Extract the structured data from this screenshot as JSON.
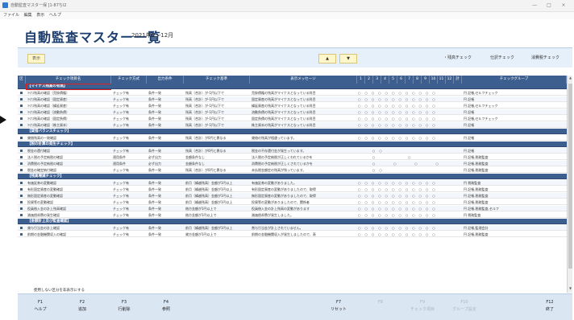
{
  "window": {
    "title": "自動監査マスター保 [1-87ちl2",
    "controls": [
      "—",
      "□",
      "×"
    ]
  },
  "menu": [
    "ファイル",
    "(E)",
    "編集",
    "(E)",
    "表示",
    "(E)",
    "ヘルプ",
    "(H)"
  ],
  "page": {
    "title": "自動監査マスター一覧",
    "period": "2021年1～12月"
  },
  "toolbar": {
    "left_button": "表示",
    "nav_left": "▲",
    "nav_right": "▼",
    "radio_labels": [
      "・残高チェック",
      "仕訳チェック",
      "消費税チェック"
    ]
  },
  "grid": {
    "columns": [
      "区",
      "チェック項目名",
      "チェック方式",
      "出力条件",
      "チェック基準",
      "表示メッセージ",
      "1",
      "2",
      "3",
      "4",
      "5",
      "6",
      "7",
      "8",
      "9",
      "10",
      "11",
      "12",
      "計",
      "チェックグループ"
    ],
    "groups": [
      {
        "title": "【マイナス残高の有無】",
        "rows": [
          {
            "name": "ﾏｲﾅｽ残高の確認（売掛債権）",
            "method": "チェック有",
            "cond": "条件一致",
            "base": "残高（合計）が-1円以下で",
            "msg": "売掛債権の残高がマイナスとなっている科目",
            "marks": "○○○○○○○○○○○○",
            "group": "円 記帳,セルフチェック"
          },
          {
            "name": "ﾏｲﾅｽ残高の確認（固定資産）",
            "method": "チェック有",
            "cond": "条件一致",
            "base": "残高（合計）が-1円以下で",
            "msg": "固定資産の残高がマイナスとなっている科目",
            "marks": "○○○○○○○○○○○○",
            "group": "円 記帳"
          },
          {
            "name": "ﾏｲﾅｽ残高の確認（繰延資産）",
            "method": "チェック有",
            "cond": "条件一致",
            "base": "残高（合計）が-1円以下で",
            "msg": "繰延資産の残高がマイナスとなっている科目",
            "marks": "○○○○○○○○○○○○",
            "group": "円 記帳,セルフチェック"
          },
          {
            "name": "ﾏｲﾅｽ残高の確認（流動負債）",
            "method": "チェック有",
            "cond": "条件一致",
            "base": "残高（合計）が-1円以下で",
            "msg": "流動負債の残高がマイナスとなっている科目",
            "marks": "○○○○○○○○○○○○",
            "group": "円 記帳"
          },
          {
            "name": "ﾏｲﾅｽ残高の確認（固定負債）",
            "method": "チェック有",
            "cond": "条件一致",
            "base": "残高（合計）が-1円以下で",
            "msg": "固定負債の残高がマイナスとなっている科目",
            "marks": "○○○○○○○○○○○○",
            "group": "円 記帳,セルフチェック"
          },
          {
            "name": "ﾏｲﾅｽ残高の確認（株主資本）",
            "method": "チェック有",
            "cond": "条件一致",
            "base": "残高（合計）が-1円以下で",
            "msg": "株主資本の残高がマイナスとなっている科目",
            "marks": "○○○○○○○○○○○○",
            "group": "円 記帳"
          }
        ]
      },
      {
        "title": "【貸借バランスチェック】",
        "rows": [
          {
            "name": "貸借残高の一致確認",
            "method": "チェック有",
            "cond": "条件一致",
            "base": "残高（合計）が0円と異なる",
            "msg": "貸借の残高が相違っています。",
            "marks": "○○○○○○○○○○○○",
            "group": "円 記帳"
          }
        ]
      },
      {
        "title": "【税の計算の発生チェック】",
        "rows": [
          {
            "name": "税金の還付確認",
            "method": "チェック有",
            "cond": "条件一致",
            "base": "残高（合計）が0円と異なる",
            "msg": "税金の不存還付金が発生っています。",
            "marks": "　　○○　　　　　　　　",
            "group": "円 記帳"
          },
          {
            "name": "法人税の予定納税の確認",
            "method": "適用条件",
            "cond": "必ず出力",
            "base": "金額条件なし",
            "msg": "法人税の予定納税が正しくわれているかを",
            "marks": "　　○　　　　○　　　　",
            "group": "円 記帳,税務監査"
          },
          {
            "name": "消費税の予定納税の確認",
            "method": "適用条件",
            "cond": "必ず出力",
            "base": "金額条件なし",
            "msg": "消費税の予定納税が正しくされているかを",
            "marks": "　　○　　○　　○　　○",
            "group": "円 記帳,税務監査"
          },
          {
            "name": "税金の確定納付確認",
            "method": "チェック有",
            "cond": "条件一致",
            "base": "残高（合計）が0円と異なる",
            "msg": "未払税金額定の残高が残っています。",
            "marks": "　　○○　　　　　　　　",
            "group": "円 記帳,税務監査"
          }
        ]
      },
      {
        "title": "【残高増減チェック】",
        "rows": [
          {
            "name": "有価証券の変動確認",
            "method": "チェック有",
            "cond": "条件一致",
            "base": "前月（繰越残高）金額が1円以上",
            "msg": "有価証券の変動がありました。",
            "marks": "○○○○○○○○○○○○",
            "group": "円 税務監査"
          },
          {
            "name": "有形固定資産の変動確認",
            "method": "チェック有",
            "cond": "条件一致",
            "base": "前月（繰越残高）金額が1円以上",
            "msg": "有形固定資産の変動がありましたので、取得",
            "marks": "○○○○○○○○○○○○",
            "group": "円 記帳,税務監査"
          },
          {
            "name": "無形固定資産の変動確認",
            "method": "チェック有",
            "cond": "条件一致",
            "base": "前月（繰越残高）金額が1円以上",
            "msg": "無形固定資産の変動がありましたので、取得",
            "marks": "○○○○○○○○○○○○",
            "group": "円 記帳,税務監査"
          },
          {
            "name": "投資等の変動確認",
            "method": "チェック有",
            "cond": "条件一致",
            "base": "前月（繰越残高）金額が1円以上",
            "msg": "投資等の変動がありましたので、関係者",
            "marks": "○○○○○○○○○○○○",
            "group": "円 記帳,税務監査"
          },
          {
            "name": "役員借入金の計上残高確認",
            "method": "チェック有",
            "cond": "条件一致",
            "base": "借方金額が1円以上で",
            "msg": "役員借入金の計上残高の変動があります",
            "marks": "○○○○○○○○○○○○",
            "group": "円 記帳,税務監査,セルフ"
          },
          {
            "name": "減価償却費の発生確認",
            "method": "チェック有",
            "cond": "条件一致",
            "base": "借方金額が1円以上で",
            "msg": "減価償却費が発生しました。",
            "marks": "○○○○○○○○○○○○",
            "group": "円 税務監査"
          }
        ]
      },
      {
        "title": "【金額計上及び監査確認】",
        "rows": [
          {
            "name": "貸与引当金の計上確認",
            "method": "チェック有",
            "cond": "条件一致",
            "base": "前月（繰越残高）金額が1円以上",
            "msg": "賞与引当金が計上されていません。",
            "marks": "○○○○○○○○○○○○",
            "group": "円 記帳,監理会計"
          },
          {
            "name": "前期の金融機関収入の確認",
            "method": "チェック有",
            "cond": "条件一致",
            "base": "貸方金額が1円以上で",
            "msg": "前期の金融機関収入が発生しましたので、表",
            "marks": "○○○○○○○○○○○○",
            "group": "円 記帳,税務監査"
          }
        ]
      }
    ]
  },
  "status_text": "使用しない区分を非表示にする",
  "fkeys": [
    {
      "key": "F1",
      "label": "ヘルプ",
      "enabled": true
    },
    {
      "key": "F2",
      "label": "追加",
      "enabled": true
    },
    {
      "key": "F3",
      "label": "行削除",
      "enabled": true
    },
    {
      "key": "F4",
      "label": "参照",
      "enabled": true
    },
    {
      "key": "F7",
      "label": "リセット",
      "enabled": true
    },
    {
      "key": "F8",
      "label": "",
      "enabled": false
    },
    {
      "key": "F9",
      "label": "チェック項目",
      "enabled": false
    },
    {
      "key": "F10",
      "label": "グループ設定",
      "enabled": false
    },
    {
      "key": "F12",
      "label": "終了",
      "enabled": true
    }
  ]
}
